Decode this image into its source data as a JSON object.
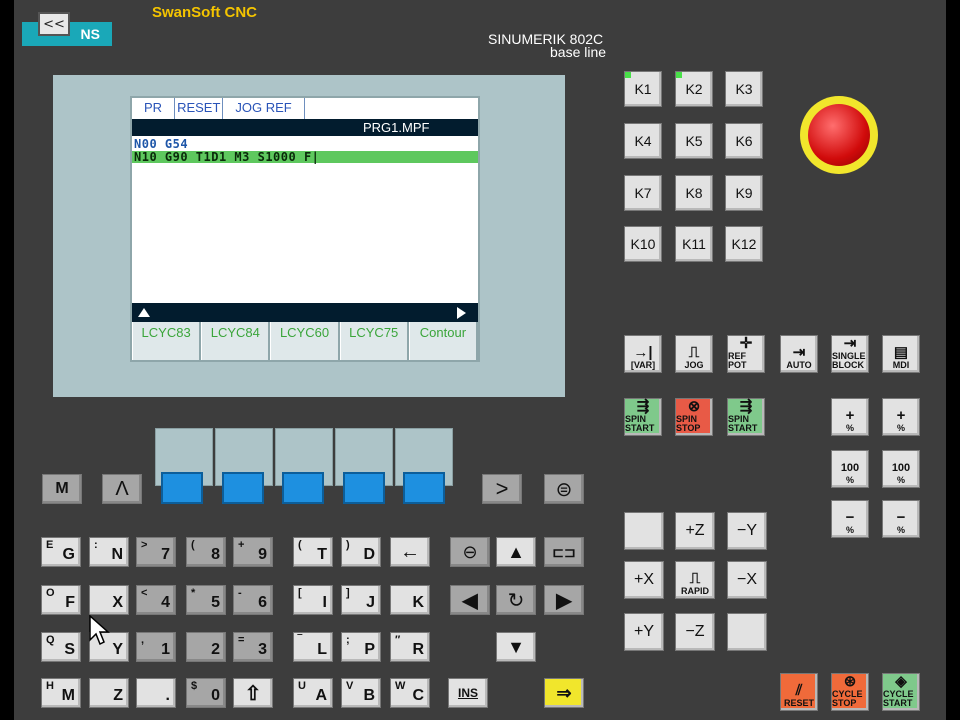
{
  "header": {
    "app_title": "SwanSoft CNC",
    "brand_text": "NS",
    "back_glyph": "<<",
    "model_line1": "SINUMERIK 802C",
    "model_line2": "base line"
  },
  "screen": {
    "tabs": [
      "PR",
      "RESET",
      "JOG REF"
    ],
    "file_name": "PRG1.MPF",
    "lines": [
      "N00 G54",
      "N10 G90 T1D1 M3 S1000 F|"
    ],
    "softkeys": [
      "LCYC83",
      "LCYC84",
      "LCYC60",
      "LCYC75",
      "Contour"
    ]
  },
  "left_keys": {
    "top_row": [
      "M",
      "Λ",
      ">",
      "⊜"
    ],
    "row1": [
      {
        "sup": "E",
        "main": "G"
      },
      {
        "sup": ":",
        "main": "N"
      },
      {
        "sup": ">",
        "main": "7"
      },
      {
        "sup": "(",
        "main": "8"
      },
      {
        "sup": "+",
        "main": "9"
      },
      {
        "sup": "(",
        "main": "T"
      },
      {
        "sup": ")",
        "main": "D"
      }
    ],
    "row2": [
      {
        "sup": "O",
        "main": "F"
      },
      {
        "sup": "",
        "main": "X"
      },
      {
        "sup": "<",
        "main": "4"
      },
      {
        "sup": "*",
        "main": "5"
      },
      {
        "sup": "-",
        "main": "6"
      },
      {
        "sup": "[",
        "main": "I"
      },
      {
        "sup": "]",
        "main": "J"
      },
      {
        "sup": "",
        "main": "K"
      }
    ],
    "row3": [
      {
        "sup": "Q",
        "main": "S"
      },
      {
        "sup": "",
        "main": "Y"
      },
      {
        "sup": ",",
        "main": "1"
      },
      {
        "sup": "",
        "main": "2"
      },
      {
        "sup": "=",
        "main": "3"
      },
      {
        "sup": "‾",
        "main": "L"
      },
      {
        "sup": ";",
        "main": "P"
      },
      {
        "sup": "″",
        "main": "R"
      }
    ],
    "row4": [
      {
        "sup": "H",
        "main": "M"
      },
      {
        "sup": "",
        "main": "Z"
      },
      {
        "sup": "",
        "main": "."
      },
      {
        "sup": "$",
        "main": "0"
      },
      {
        "sup": "",
        "main": "⇧"
      },
      {
        "sup": "U",
        "main": "A"
      },
      {
        "sup": "V",
        "main": "B"
      },
      {
        "sup": "W",
        "main": "C"
      },
      {
        "sup": "",
        "main": "INS"
      }
    ]
  },
  "k_keys": [
    "K1",
    "K2",
    "K3",
    "K4",
    "K5",
    "K6",
    "K7",
    "K8",
    "K9",
    "K10",
    "K11",
    "K12"
  ],
  "mode_keys": [
    {
      "glyph": "→|",
      "label": "[VAR]"
    },
    {
      "glyph": "⎍",
      "label": "JOG"
    },
    {
      "glyph": "✛",
      "label": "REF POT"
    },
    {
      "glyph": "⇥",
      "label": "AUTO"
    },
    {
      "glyph": "⇥",
      "label": "SINGLE BLOCK"
    },
    {
      "glyph": "▤",
      "label": "MDI"
    }
  ],
  "spindle_keys": [
    {
      "label": "SPIN START",
      "color": "green"
    },
    {
      "label": "SPIN STOP",
      "color": "red"
    },
    {
      "label": "SPIN START",
      "color": "green"
    }
  ],
  "override_keys": [
    {
      "top": "+",
      "label": "%"
    },
    {
      "top": "+",
      "label": "%"
    },
    {
      "top": "100",
      "label": "%"
    },
    {
      "top": "100",
      "label": "%"
    },
    {
      "top": "−",
      "label": "%"
    },
    {
      "top": "−",
      "label": "%"
    }
  ],
  "axis_keys": [
    "",
    "+Z",
    "−Y",
    "+X",
    "RAPID",
    "−X",
    "+Y",
    "−Z",
    ""
  ],
  "bottom_keys": [
    {
      "label": "RESET"
    },
    {
      "label": "CYCLE STOP"
    },
    {
      "label": "CYCLE START"
    }
  ]
}
